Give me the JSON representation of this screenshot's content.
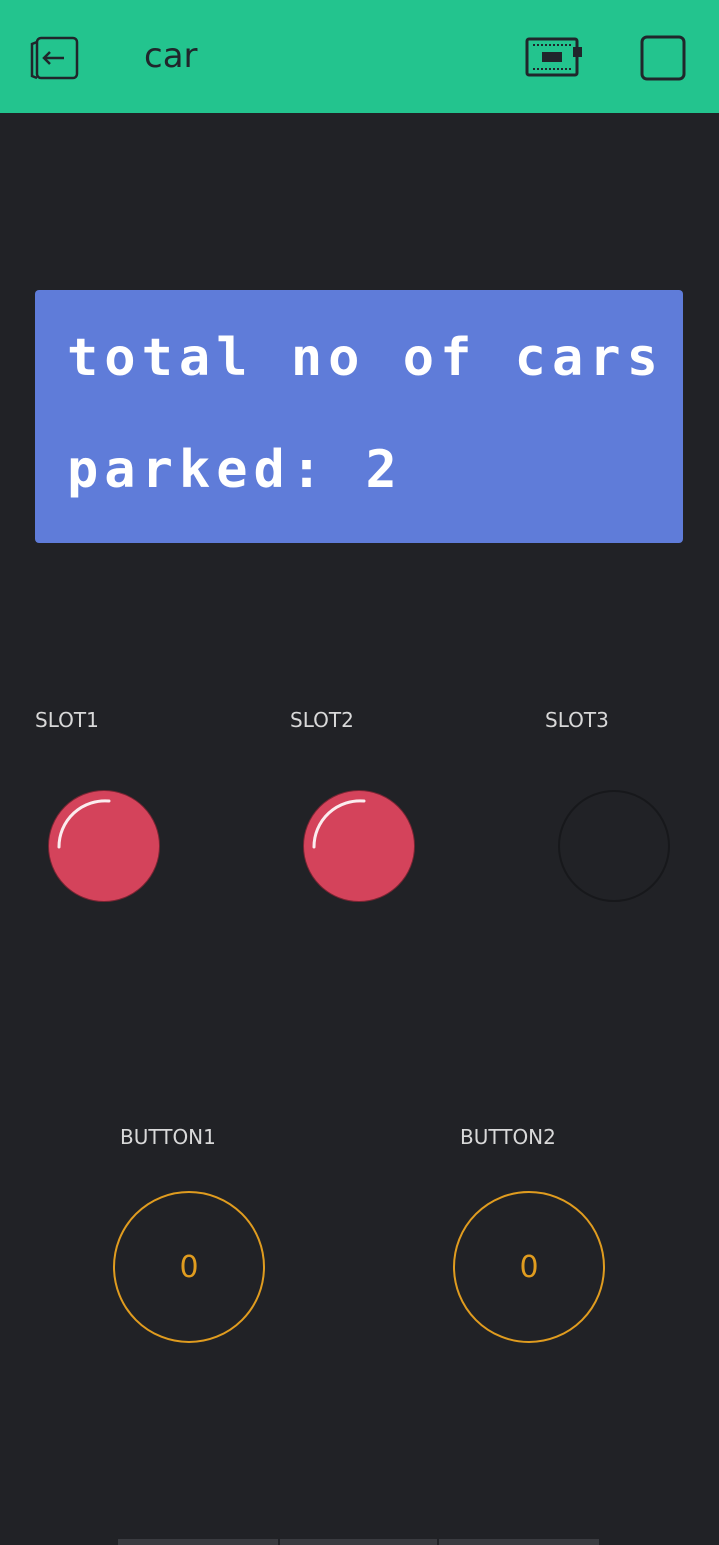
{
  "header": {
    "title": "car",
    "background": "#23c48e",
    "back_icon": "exit-icon",
    "device_icon": "device-board-icon",
    "stop_icon": "stop-square-icon"
  },
  "lcd": {
    "line1": "total no of cars",
    "line2": "parked: 2",
    "background": "#5f7cd9",
    "text_color": "#ffffff"
  },
  "leds": [
    {
      "label": "SLOT1",
      "state": "on",
      "color": "#d4435b"
    },
    {
      "label": "SLOT2",
      "state": "on",
      "color": "#d4435b"
    },
    {
      "label": "SLOT3",
      "state": "off",
      "color": "#d4435b"
    }
  ],
  "buttons": [
    {
      "label": "BUTTON1",
      "value": "0",
      "color": "#e09c1f"
    },
    {
      "label": "BUTTON2",
      "value": "0",
      "color": "#e09c1f"
    }
  ]
}
